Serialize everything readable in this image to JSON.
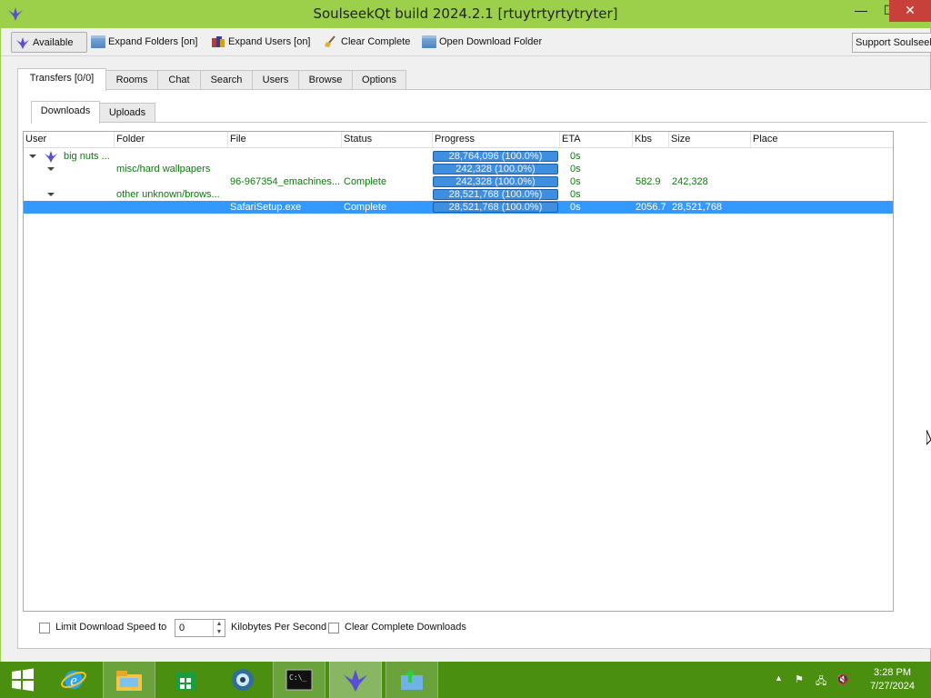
{
  "window": {
    "title": "SoulseekQt build 2024.2.1 [rtuytrtyrtytryter]",
    "minimize_glyph": "—",
    "maximize_glyph": "☐",
    "close_glyph": "✕"
  },
  "toolbar": {
    "available_label": "Available",
    "expand_folders_label": "Expand Folders [on]",
    "expand_users_label": "Expand Users [on]",
    "clear_complete_label": "Clear Complete",
    "open_download_folder_label": "Open Download Folder",
    "support_label": "Support Soulseek"
  },
  "main_tabs": [
    "Transfers [0/0]",
    "Rooms",
    "Chat",
    "Search",
    "Users",
    "Browse",
    "Options"
  ],
  "sub_tabs": [
    "Downloads",
    "Uploads"
  ],
  "columns": [
    "User",
    "Folder",
    "File",
    "Status",
    "Progress",
    "ETA",
    "Kbs",
    "Size",
    "Place"
  ],
  "rows": [
    {
      "user": "big nuts ...",
      "folder": "",
      "file": "",
      "status": "",
      "progress": "28,764,096 (100.0%)",
      "eta": "0s",
      "kbs": "",
      "size": "",
      "place": ""
    },
    {
      "user": "",
      "folder": "misc/hard wallpapers",
      "file": "",
      "status": "",
      "progress": "242,328 (100.0%)",
      "eta": "0s",
      "kbs": "",
      "size": "",
      "place": ""
    },
    {
      "user": "",
      "folder": "",
      "file": "96-967354_emachines...",
      "status": "Complete",
      "progress": "242,328 (100.0%)",
      "eta": "0s",
      "kbs": "582.9",
      "size": "242,328",
      "place": ""
    },
    {
      "user": "",
      "folder": "other unknown/brows...",
      "file": "",
      "status": "",
      "progress": "28,521,768 (100.0%)",
      "eta": "0s",
      "kbs": "",
      "size": "",
      "place": ""
    },
    {
      "user": "",
      "folder": "",
      "file": "SafariSetup.exe",
      "status": "Complete",
      "progress": "28,521,768 (100.0%)",
      "eta": "0s",
      "kbs": "2056.7",
      "size": "28,521,768",
      "place": ""
    }
  ],
  "bottom": {
    "limit_label": "Limit Download Speed to",
    "speed_value": "0",
    "unit_label": "Kilobytes Per Second",
    "clear_label": "Clear Complete Downloads"
  },
  "taskbar": {
    "time": "3:28 PM",
    "date": "7/27/2024"
  },
  "colors": {
    "accent": "#9ccf4a",
    "taskbar": "#4a8f10",
    "selection": "#3399ff",
    "progress": "#3e8fe0",
    "tree_text": "#0d7a0d",
    "close": "#c7403a"
  }
}
